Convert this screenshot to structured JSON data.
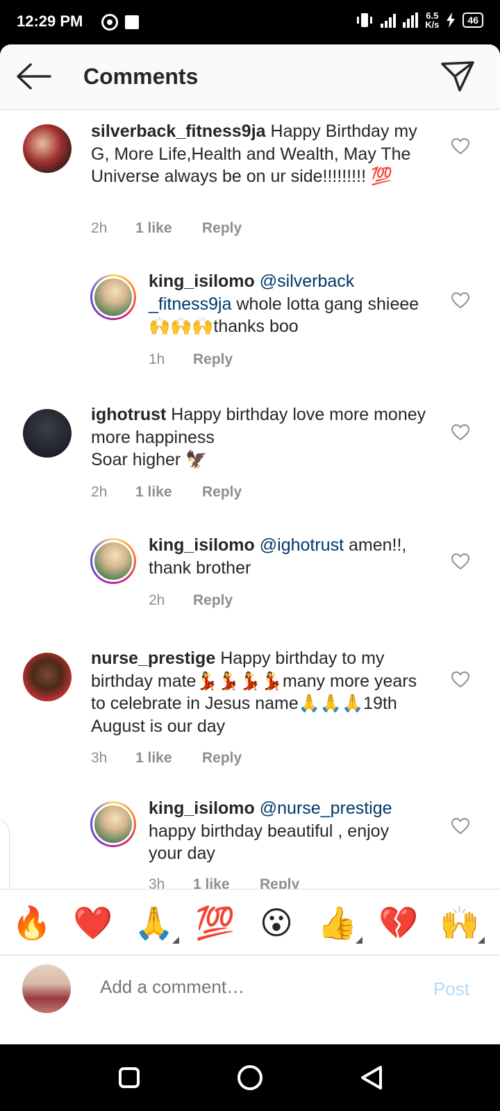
{
  "status_bar": {
    "time": "12:29 PM",
    "network_speed_value": "6.5",
    "network_speed_unit": "K/s",
    "battery": "46"
  },
  "header": {
    "title": "Comments",
    "back_icon": "arrow-left-icon",
    "share_icon": "paper-plane-icon"
  },
  "comments": [
    {
      "username": "silverback_fitness9ja",
      "text": "Happy Birthday my G, More Life,Health and Wealth, May The Universe always be on ur side!!!!!!!!! 💯",
      "time": "2h",
      "likes": "1 like",
      "reply": "Reply",
      "is_reply": false
    },
    {
      "username": "king_isilomo",
      "mention": "@silverback _fitness9ja",
      "text": "whole lotta gang shieee 🙌🙌🙌thanks boo",
      "time": "1h",
      "likes": "",
      "reply": "Reply",
      "is_reply": true
    },
    {
      "username": "ighotrust",
      "text": "Happy birthday love more money more happiness",
      "text2": "Soar higher 🦅",
      "time": "2h",
      "likes": "1 like",
      "reply": "Reply",
      "is_reply": false
    },
    {
      "username": "king_isilomo",
      "mention": "@ighotrust",
      "text": "amen!!, thank brother",
      "time": "2h",
      "likes": "",
      "reply": "Reply",
      "is_reply": true
    },
    {
      "username": "nurse_prestige",
      "text": "Happy birthday to my birthday mate💃💃💃💃many more years to celebrate in Jesus name🙏🙏🙏19th August is our day",
      "time": "3h",
      "likes": "1 like",
      "reply": "Reply",
      "is_reply": false
    },
    {
      "username": "king_isilomo",
      "mention": "@nurse_prestige",
      "text": "happy birthday beautiful , enjoy your day",
      "time": "3h",
      "likes": "1 like",
      "reply": "Reply",
      "is_reply": true
    }
  ],
  "emoji_bar": {
    "items": [
      "🔥",
      "❤️",
      "🙏",
      "💯",
      "😮",
      "👍",
      "💔",
      "🙌"
    ]
  },
  "composer": {
    "placeholder": "Add a comment…",
    "post_label": "Post"
  },
  "colors": {
    "mention": "#00376b",
    "meta_gray": "#8e8e8e",
    "post_disabled": "#b3dbff"
  }
}
